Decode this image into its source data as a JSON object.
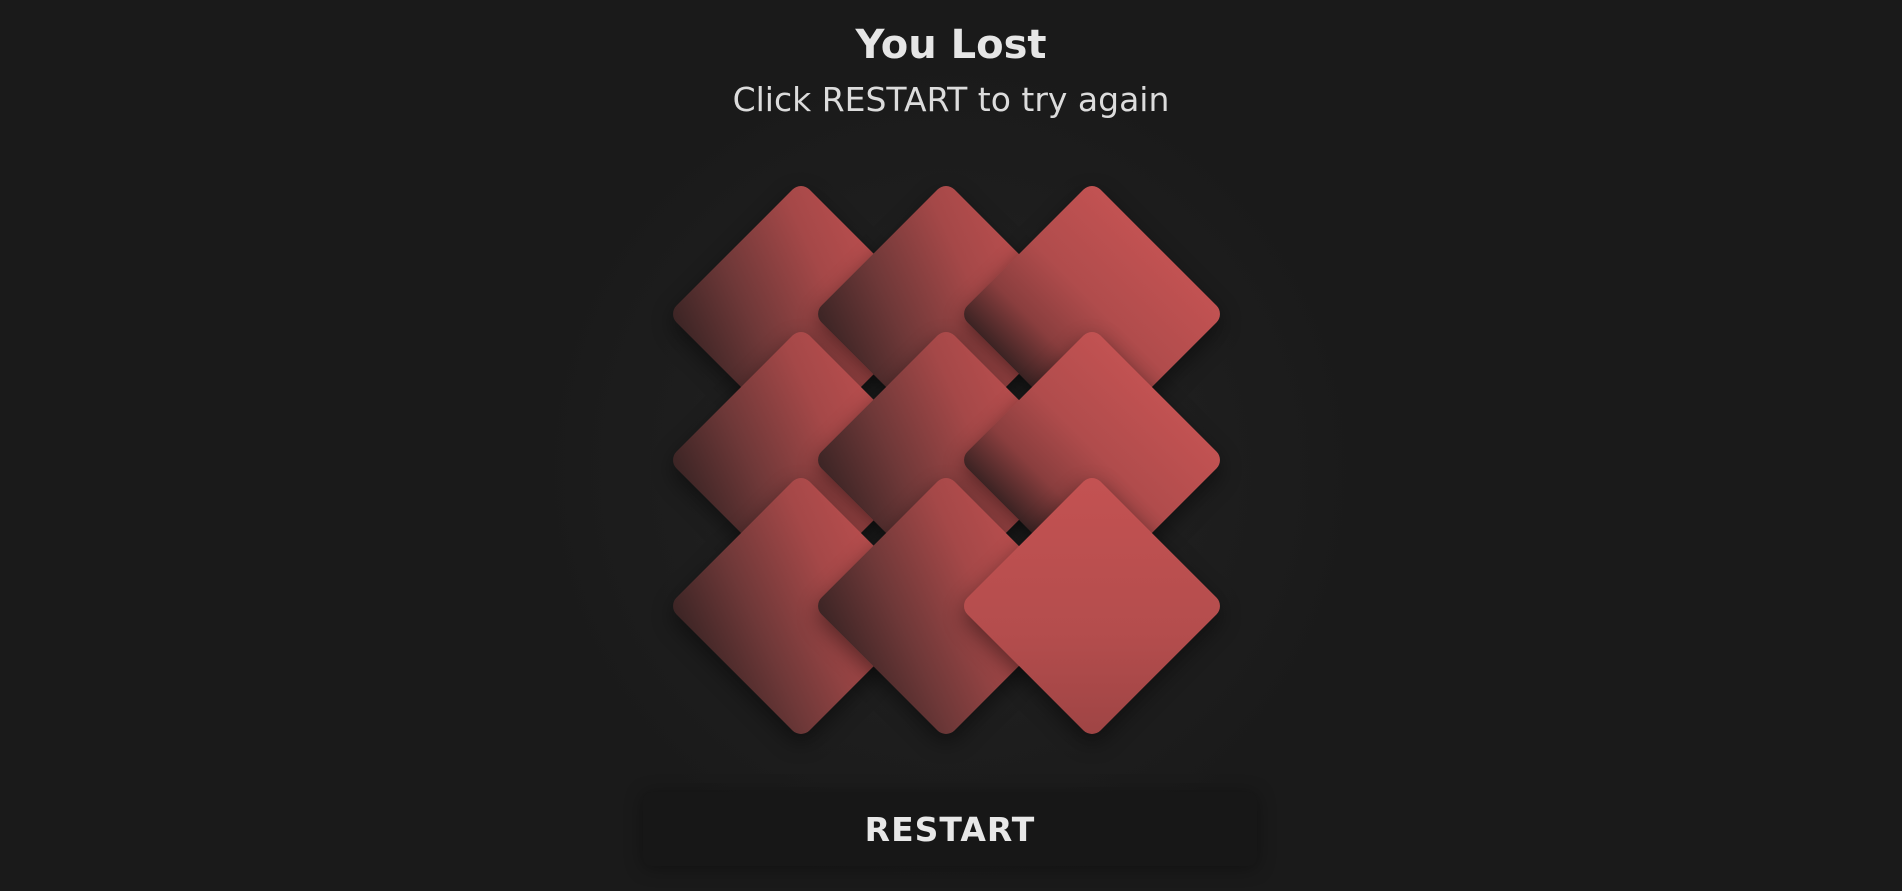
{
  "status": {
    "title": "You Lost",
    "subtitle": "Click RESTART to try again"
  },
  "board": {
    "rows": 3,
    "cols": 3,
    "tile_color": "#c05050",
    "background_color": "#1a1a1a"
  },
  "controls": {
    "restart_label": "RESTART"
  }
}
